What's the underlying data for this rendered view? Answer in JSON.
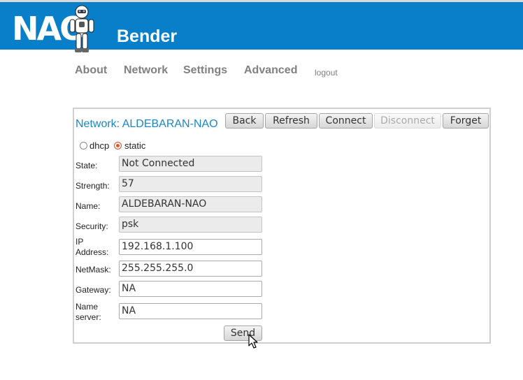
{
  "header": {
    "logo": "NAO",
    "robot_icon": "nao-robot-icon",
    "title": "Bender"
  },
  "nav": {
    "about": "About",
    "network": "Network",
    "settings": "Settings",
    "advanced": "Advanced",
    "logout": "logout"
  },
  "panel": {
    "title": "Network: ALDEBARAN-NAO",
    "buttons": {
      "back": "Back",
      "refresh": "Refresh",
      "connect": "Connect",
      "disconnect": "Disconnect",
      "forget": "Forget"
    },
    "mode": {
      "dhcp": "dhcp",
      "static": "static",
      "selected": "static"
    },
    "fields": {
      "state": {
        "label": "State:",
        "value": "Not Connected"
      },
      "strength": {
        "label": "Strength:",
        "value": "57"
      },
      "name": {
        "label": "Name:",
        "value": "ALDEBARAN-NAO"
      },
      "security": {
        "label": "Security:",
        "value": "psk"
      },
      "ip": {
        "label_1": "IP",
        "label_2": "Address:",
        "value": "192.168.1.100"
      },
      "netmask": {
        "label": "NetMask:",
        "value": "255.255.255.0"
      },
      "gateway": {
        "label": "Gateway:",
        "value": "NA"
      },
      "nameserver": {
        "label_1": "Name",
        "label_2": "server:",
        "value": "NA"
      }
    },
    "send": "Send"
  },
  "colors": {
    "header": "#0a7fc9",
    "title": "#1a86c8",
    "radio_selected": "#e0552a"
  }
}
